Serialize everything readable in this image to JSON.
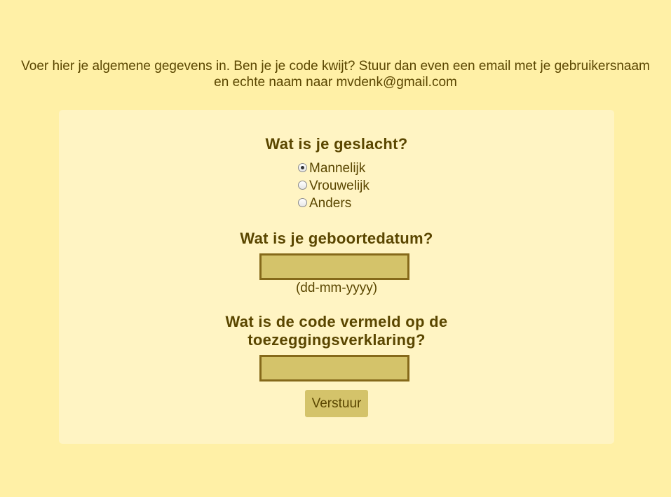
{
  "intro": {
    "line1": "Voer hier je algemene gegevens in. Ben je je code kwijt? Stuur dan even een email met je gebruikersnaam",
    "line2": "en echte naam naar mvdenk@gmail.com"
  },
  "form": {
    "gender": {
      "question": "Wat is je geslacht?",
      "options": [
        {
          "label": "Mannelijk",
          "checked": true
        },
        {
          "label": "Vrouwelijk",
          "checked": false
        },
        {
          "label": "Anders",
          "checked": false
        }
      ]
    },
    "birthdate": {
      "question": "Wat is je geboortedatum?",
      "value": "",
      "hint": "(dd-mm-yyyy)"
    },
    "code": {
      "question_line1": "Wat is de code vermeld op de",
      "question_line2": "toezeggingsverklaring?",
      "value": ""
    },
    "submit_label": "Verstuur"
  },
  "colors": {
    "page_background": "#fff0a6",
    "card_background": "#fff4c3",
    "input_background": "#d4c36a",
    "input_border": "#85691a",
    "text": "#5a4600"
  }
}
